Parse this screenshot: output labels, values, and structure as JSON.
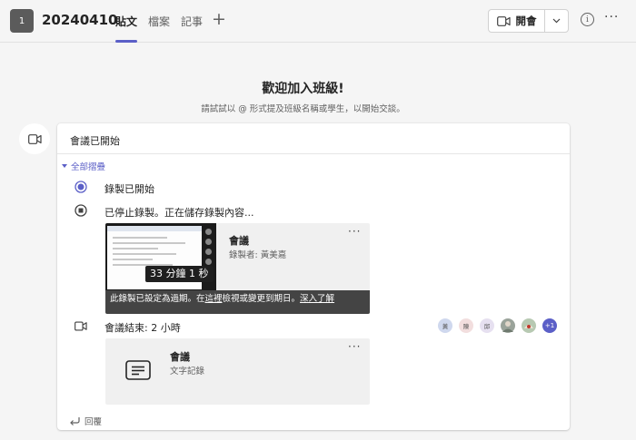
{
  "header": {
    "team_initial": "1",
    "team_name": "20240410",
    "tabs": [
      "貼文",
      "檔案",
      "記事"
    ],
    "add_tab": "+",
    "meet_label": "開會",
    "info_label": "i",
    "more_label": "···"
  },
  "welcome": {
    "title": "歡迎加入班級!",
    "subtitle": "請試試以 @ 形式提及班級名稱或學生，以開始交談。"
  },
  "meeting": {
    "title": "會議已開始",
    "collapse_label": "全部摺疊",
    "events": {
      "recording_started": "錄製已開始",
      "recording_stopped": "已停止錄製。正在儲存錄製內容..."
    },
    "recording": {
      "duration": "33 分鐘 1 秒",
      "title": "會議",
      "recorded_by": "錄製者: 黃美嘉",
      "more": "···",
      "expiry_prefix": "此錄製已設定為過期。在",
      "here_link": "這裡",
      "expiry_middle": "檢視或變更到期日。",
      "learn_more": "深入了解"
    },
    "ended": "會議結束: 2 小時",
    "participants": [
      {
        "initial": "黃",
        "color": "#cfd8ee"
      },
      {
        "initial": "陳",
        "color": "#f2dede"
      },
      {
        "initial": "邱",
        "color": "#e6e0f0"
      },
      {
        "initial": "",
        "color": "#9aa39a"
      },
      {
        "initial": "",
        "color": "#b7c9b2"
      }
    ],
    "more_participants": "+1",
    "notes": {
      "title": "會議",
      "subtitle": "文字記錄",
      "more": "···"
    },
    "reply_label": "回覆"
  },
  "colors": {
    "accent": "#5b5fc7",
    "background": "#f5f5f5"
  }
}
